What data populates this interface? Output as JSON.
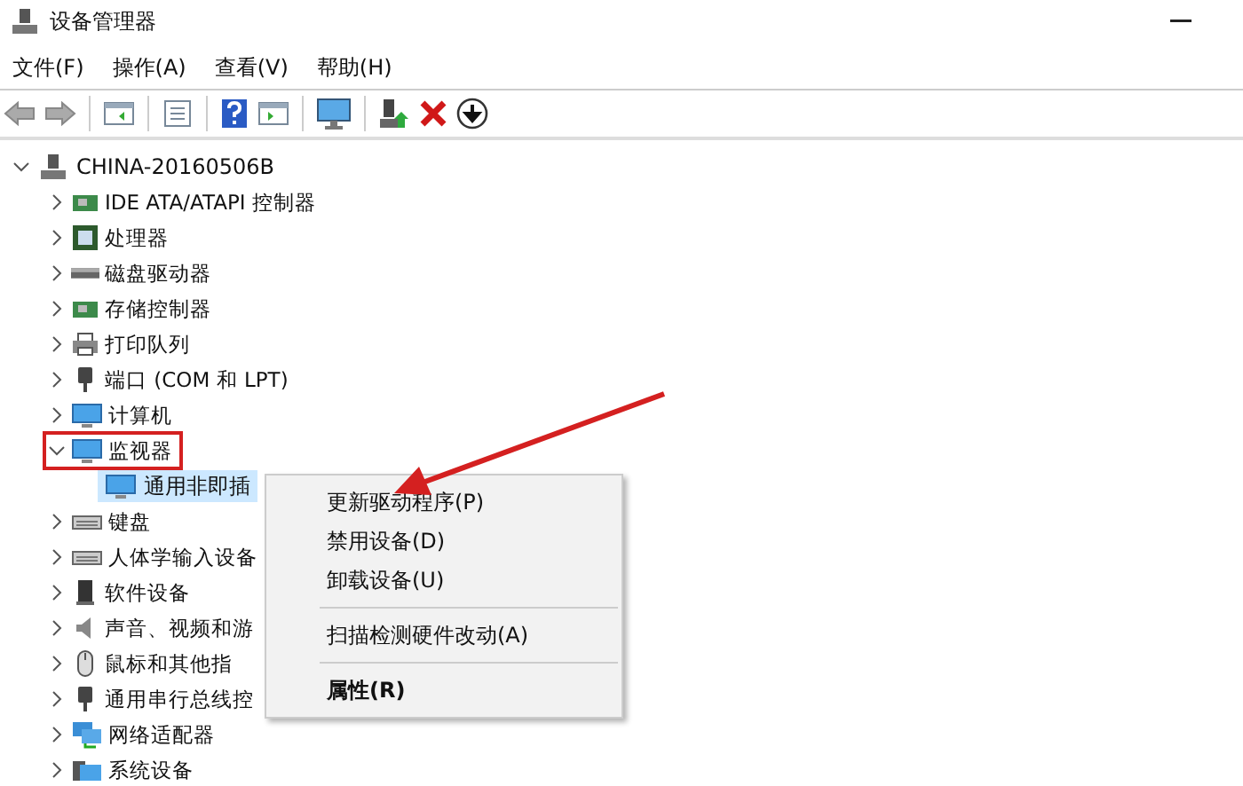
{
  "window": {
    "title": "设备管理器"
  },
  "menu": [
    "文件(F)",
    "操作(A)",
    "查看(V)",
    "帮助(H)"
  ],
  "tree": {
    "label": "CHINA-20160506B",
    "expanded": true,
    "children": [
      {
        "label": "IDE ATA/ATAPI 控制器",
        "expanded": false,
        "highlighted": false
      },
      {
        "label": "处理器",
        "expanded": false,
        "highlighted": false
      },
      {
        "label": "磁盘驱动器",
        "expanded": false,
        "highlighted": false
      },
      {
        "label": "存储控制器",
        "expanded": false,
        "highlighted": false
      },
      {
        "label": "打印队列",
        "expanded": false,
        "highlighted": false
      },
      {
        "label": "端口 (COM 和 LPT)",
        "expanded": false,
        "highlighted": false
      },
      {
        "label": "计算机",
        "expanded": false,
        "highlighted": false
      },
      {
        "label": "监视器",
        "expanded": true,
        "highlighted": true,
        "children": [
          {
            "label": "通用非即插",
            "selected": true
          }
        ]
      },
      {
        "label": "键盘",
        "expanded": false,
        "highlighted": false
      },
      {
        "label": "人体学输入设备",
        "expanded": false,
        "highlighted": false
      },
      {
        "label": "软件设备",
        "expanded": false,
        "highlighted": false
      },
      {
        "label": "声音、视频和游",
        "expanded": false,
        "highlighted": false
      },
      {
        "label": "鼠标和其他指",
        "expanded": false,
        "highlighted": false
      },
      {
        "label": "通用串行总线控",
        "expanded": false,
        "highlighted": false
      },
      {
        "label": "网络适配器",
        "expanded": false,
        "highlighted": false
      },
      {
        "label": "系统设备",
        "expanded": false,
        "highlighted": false
      }
    ]
  },
  "context_menu": {
    "items": [
      {
        "kind": "item",
        "label": "更新驱动程序(P)"
      },
      {
        "kind": "item",
        "label": "禁用设备(D)"
      },
      {
        "kind": "item",
        "label": "卸载设备(U)"
      },
      {
        "kind": "separator"
      },
      {
        "kind": "item",
        "label": "扫描检测硬件改动(A)"
      },
      {
        "kind": "separator"
      },
      {
        "kind": "default",
        "label": "属性(R)"
      }
    ]
  }
}
